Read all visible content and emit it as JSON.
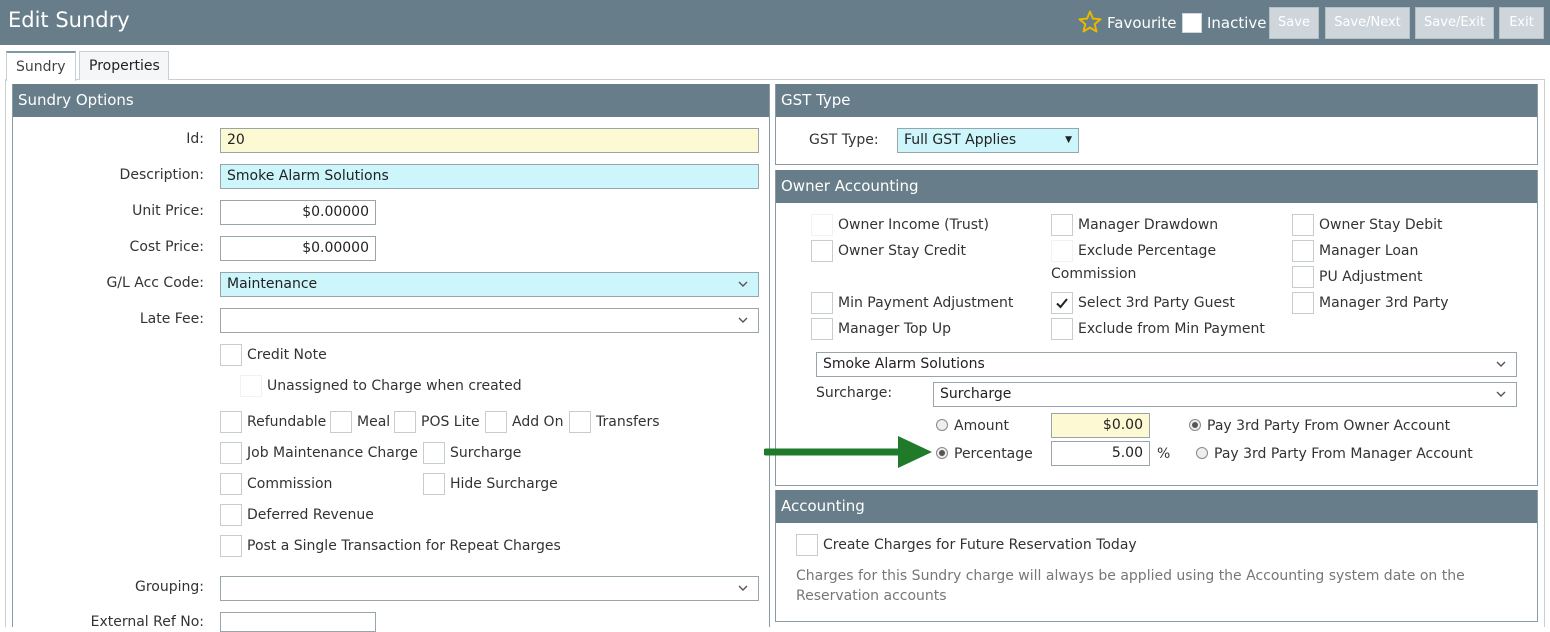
{
  "header": {
    "title": "Edit Sundry",
    "favourite_label": "Favourite",
    "inactive_label": "Inactive",
    "buttons": {
      "save": "Save",
      "save_next": "Save/Next",
      "save_exit": "Save/Exit",
      "exit": "Exit"
    }
  },
  "tabs": [
    {
      "label": "Sundry",
      "active": true
    },
    {
      "label": "Properties",
      "active": false
    }
  ],
  "sundry_options": {
    "title": "Sundry Options",
    "id": {
      "label": "Id:",
      "value": "20"
    },
    "description": {
      "label": "Description:",
      "value": "Smoke Alarm Solutions"
    },
    "unit_price": {
      "label": "Unit Price:",
      "value": "$0.00000"
    },
    "cost_price": {
      "label": "Cost Price:",
      "value": "$0.00000"
    },
    "gl_acc_code": {
      "label": "G/L Acc Code:",
      "value": "Maintenance"
    },
    "late_fee": {
      "label": "Late Fee:",
      "value": ""
    },
    "checkboxes": {
      "credit_note": "Credit Note",
      "unassigned": "Unassigned to Charge when created",
      "refundable": "Refundable",
      "meal": "Meal",
      "pos_lite": "POS Lite",
      "add_on": "Add On",
      "transfers": "Transfers",
      "job_maintenance": "Job Maintenance Charge",
      "surcharge": "Surcharge",
      "commission": "Commission",
      "hide_surcharge": "Hide Surcharge",
      "deferred_revenue": "Deferred Revenue",
      "post_single": "Post a Single Transaction for Repeat Charges"
    },
    "grouping": {
      "label": "Grouping:",
      "value": ""
    },
    "external_ref": {
      "label": "External Ref No:",
      "value": ""
    }
  },
  "gst": {
    "title": "GST Type",
    "label": "GST Type:",
    "value": "Full GST Applies"
  },
  "owner_accounting": {
    "title": "Owner Accounting",
    "options": {
      "owner_income": "Owner Income (Trust)",
      "manager_drawdown": "Manager Drawdown",
      "owner_stay_debit": "Owner Stay Debit",
      "owner_stay_credit": "Owner Stay Credit",
      "exclude_pct_commission_1": "Exclude Percentage",
      "exclude_pct_commission_2": "Commission",
      "manager_loan": "Manager Loan",
      "pu_adjustment": "PU Adjustment",
      "min_payment_adj": "Min Payment Adjustment",
      "select_3rd_party_guest": "Select 3rd Party Guest",
      "manager_3rd_party": "Manager 3rd Party",
      "manager_top_up": "Manager Top Up",
      "exclude_min_payment": "Exclude from Min Payment"
    },
    "third_party_value": "Smoke Alarm Solutions",
    "surcharge_label": "Surcharge:",
    "surcharge_value": "Surcharge",
    "amount_label": "Amount",
    "amount_value": "$0.00",
    "percentage_label": "Percentage",
    "percentage_value": "5.00",
    "percent_sign": "%",
    "pay_owner": "Pay 3rd Party From Owner Account",
    "pay_manager": "Pay 3rd Party From Manager Account",
    "selected_method": "percentage",
    "selected_pay": "owner"
  },
  "accounting": {
    "title": "Accounting",
    "create_charges": "Create Charges for Future Reservation Today",
    "note": "Charges for this Sundry charge will always be applied using the Accounting system date on the Reservation accounts"
  },
  "colors": {
    "header": "#677d8a",
    "arrow": "#1f7a2a",
    "star": "#e6b800"
  }
}
